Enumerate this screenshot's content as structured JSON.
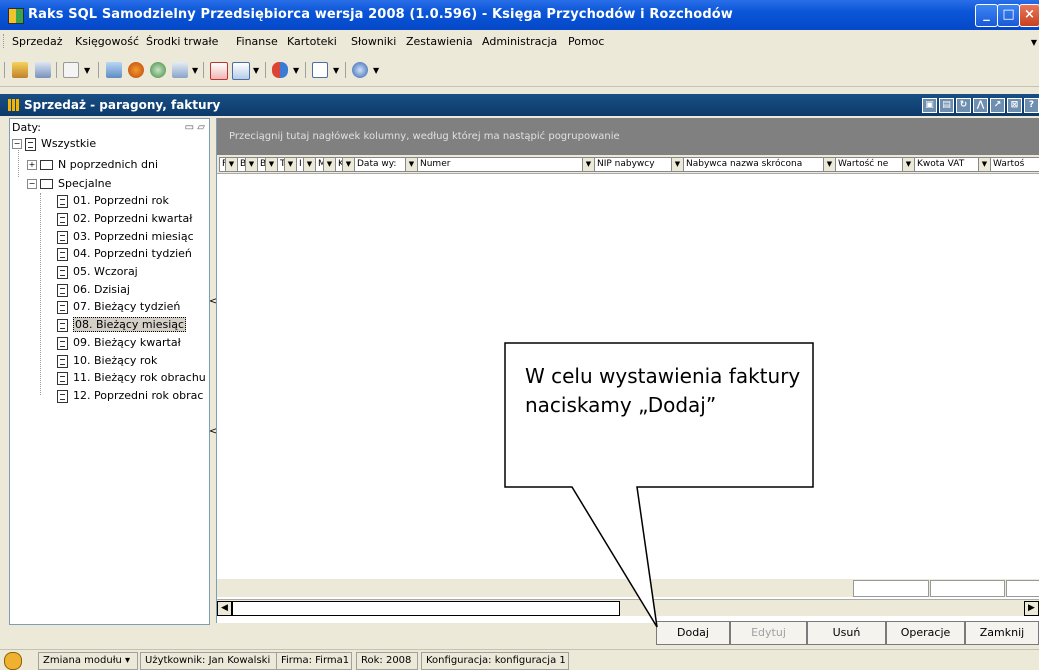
{
  "window": {
    "title": "Raks SQL Samodzielny Przedsiębiorca wersja 2008 (1.0.596) - Księga Przychodów i Rozchodów"
  },
  "menu": [
    "Sprzedaż",
    "Księgowość",
    "Środki trwałe",
    "Finanse",
    "Kartoteki",
    "Słowniki",
    "Zestawienia",
    "Administracja",
    "Pomoc"
  ],
  "module": {
    "title": "Sprzedaż - paragony, faktury",
    "buttons": [
      "▣",
      "▤",
      "↻",
      "⋀",
      "↗",
      "⊠",
      "?"
    ]
  },
  "tree": {
    "header": "Daty:",
    "root": "Wszystkie",
    "groups": [
      "N poprzednich dni",
      "Specjalne"
    ],
    "items": [
      "01. Poprzedni rok",
      "02. Poprzedni kwartał",
      "03. Poprzedni miesiąc",
      "04. Poprzedni tydzień",
      "05. Wczoraj",
      "06. Dzisiaj",
      "07. Bieżący tydzień",
      "08. Bieżący miesiąc",
      "09. Bieżący kwartał",
      "10. Bieżący rok",
      "11. Bieżący rok obrachu",
      "12. Poprzedni rok obrac"
    ],
    "selected_index": 7
  },
  "grid": {
    "group_hint": "Przeciągnij tutaj nagłówek kolumny, według której ma nastąpić pogrupowanie",
    "columns": [
      "F",
      "Bl",
      "Bl",
      "T",
      "I",
      "M",
      "K",
      "Data wy:",
      "Numer",
      "NIP nabywcy",
      "Nabywca nazwa skrócona",
      "Wartość ne",
      "Kwota VAT",
      "Wartoś"
    ]
  },
  "buttons": {
    "add": "Dodaj",
    "edit": "Edytuj",
    "delete": "Usuń",
    "operations": "Operacje",
    "close": "Zamknij"
  },
  "callout": {
    "text": "W celu wystawienia faktury naciskamy „Dodaj”"
  },
  "status": {
    "module": "Zmiana modułu",
    "user": "Użytkownik: Jan Kowalski",
    "company": "Firma: Firma1",
    "year": "Rok: 2008",
    "config": "Konfiguracja: konfiguracja 1"
  }
}
